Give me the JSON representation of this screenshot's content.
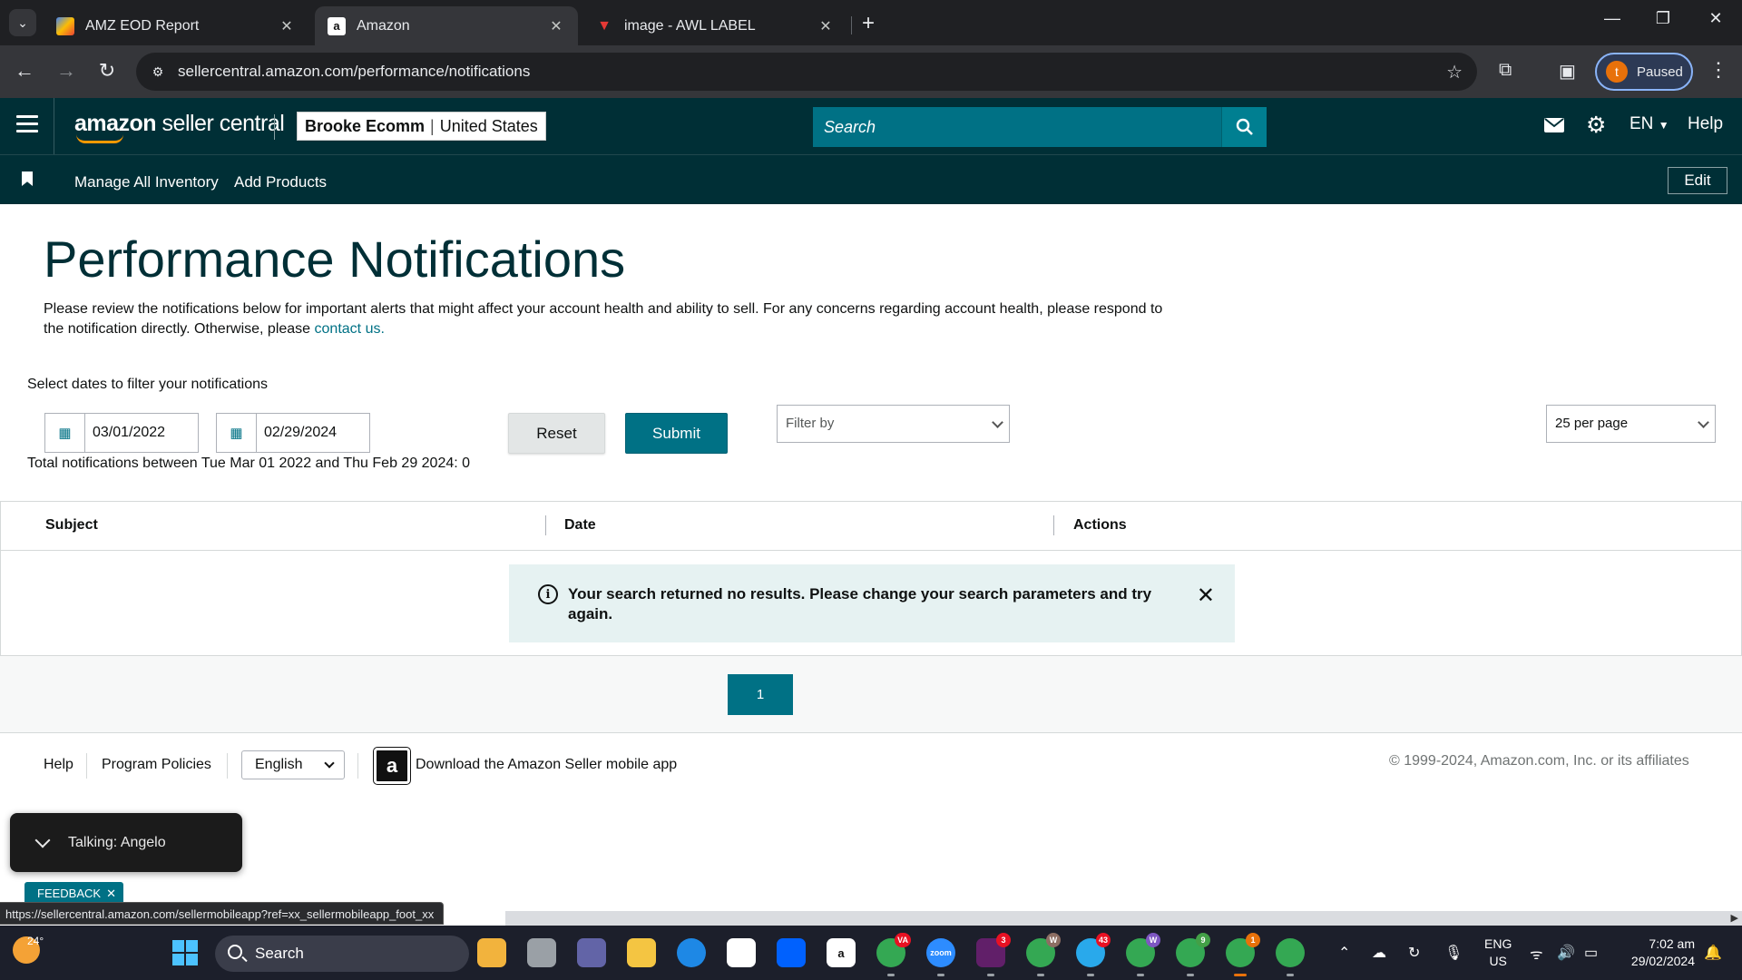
{
  "browser": {
    "tabs": [
      {
        "title": "AMZ EOD Report",
        "icon": "report-favicon",
        "active": false
      },
      {
        "title": "Amazon",
        "icon": "amazon-favicon",
        "active": true
      },
      {
        "title": "image - AWL LABEL",
        "icon": "awl-favicon",
        "active": false
      }
    ],
    "url": "sellercentral.amazon.com/performance/notifications",
    "profile_initial": "t",
    "profile_status": "Paused"
  },
  "header": {
    "logo_text_bold": "amazon",
    "logo_text": "seller central",
    "store_name": "Brooke Ecomm",
    "store_region": "United States",
    "search_placeholder": "Search",
    "language": "EN",
    "help": "Help"
  },
  "subnav": {
    "links": [
      "Manage All Inventory",
      "Add Products"
    ],
    "edit": "Edit"
  },
  "page": {
    "title": "Performance Notifications",
    "intro": "Please review the notifications below for important alerts that might affect your account health and ability to sell. For any concerns regarding account health, please respond to the notification directly. Otherwise, please",
    "contact_link": "contact us.",
    "filter_label": "Select dates to filter your notifications",
    "start_date": "03/01/2022",
    "end_date": "02/29/2024",
    "total_text": "Total notifications between Tue Mar 01 2022 and Thu Feb 29 2024: 0",
    "reset": "Reset",
    "submit": "Submit",
    "filter_by": "Filter by",
    "per_page": "25 per page"
  },
  "table": {
    "columns": [
      "Subject",
      "Date",
      "Actions"
    ],
    "empty_message": "Your search returned no results. Please change your search parameters and try again."
  },
  "pagination": {
    "current_page": "1"
  },
  "footer": {
    "help": "Help",
    "program_policies": "Program Policies",
    "language": "English",
    "app_download": "Download the Amazon Seller mobile app",
    "copyright": "© 1999-2024, Amazon.com, Inc. or its affiliates"
  },
  "overlays": {
    "talking": "Talking: Angelo",
    "feedback": "FEEDBACK",
    "status_url": "https://sellercentral.amazon.com/sellermobileapp?ref=xx_sellermobileapp_foot_xx"
  },
  "taskbar": {
    "temperature": "24°",
    "search": "Search",
    "lang_line1": "ENG",
    "lang_line2": "US",
    "time": "7:02 am",
    "date": "29/02/2024",
    "badges": {
      "va": "VA",
      "slack": "3",
      "w1": "W",
      "telegram": "43",
      "w2": "W",
      "g9": "9",
      "chrome_active": "1"
    }
  },
  "colors": {
    "header_bg": "#002f36",
    "accent": "#007185",
    "alert_bg": "#e6f2f2"
  }
}
